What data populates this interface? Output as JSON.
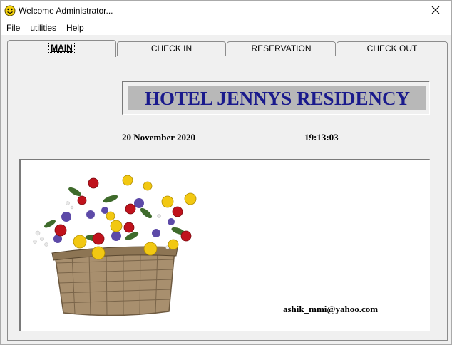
{
  "window": {
    "title": "Welcome Administrator...",
    "icon": "smiley-app-icon",
    "close_icon": "close-icon"
  },
  "menu": [
    "File",
    "utilities",
    "Help"
  ],
  "tabs": [
    {
      "label": "MAIN",
      "active": true
    },
    {
      "label": "CHECK IN",
      "active": false
    },
    {
      "label": "RESERVATION",
      "active": false
    },
    {
      "label": "CHECK OUT",
      "active": false
    }
  ],
  "main": {
    "hotel_name": "HOTEL JENNYS RESIDENCY",
    "date": "20 November 2020",
    "time": "19:13:03",
    "email": "ashik_mmi@yahoo.com",
    "image": "flower-basket-image"
  },
  "colors": {
    "hotel_name_text": "#1a1a8c",
    "hotel_name_background": "#b8b8b8",
    "panel_background": "#f0f0f0"
  }
}
